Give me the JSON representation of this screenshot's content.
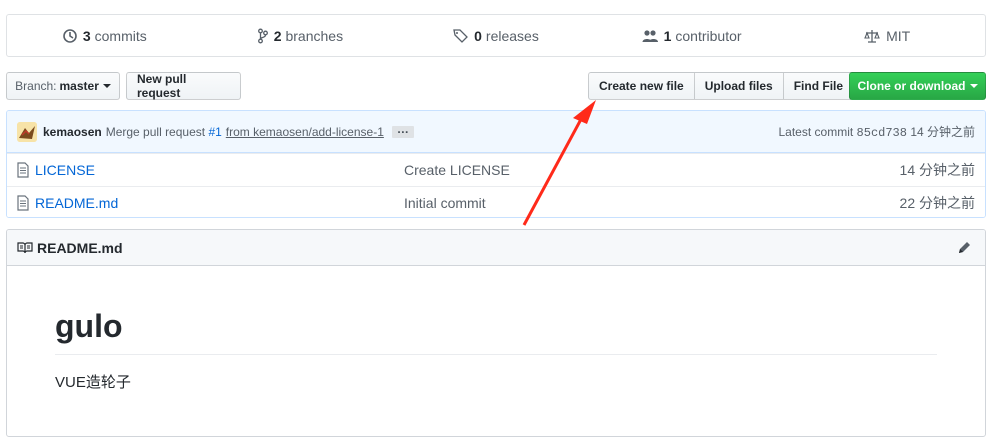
{
  "summary": {
    "commits": {
      "count": "3",
      "label": "commits"
    },
    "branches": {
      "count": "2",
      "label": "branches"
    },
    "releases": {
      "count": "0",
      "label": "releases"
    },
    "contributors": {
      "count": "1",
      "label": "contributor"
    },
    "license": "MIT"
  },
  "toolbar": {
    "branch_prefix": "Branch:",
    "branch_name": "master",
    "new_pull_request": "New pull request",
    "create_new_file": "Create new file",
    "upload_files": "Upload files",
    "find_file": "Find File",
    "clone_or_download": "Clone or download"
  },
  "latest_commit": {
    "author": "kemaosen",
    "message_prefix": "Merge pull request",
    "pr_number": "#1",
    "message_suffix": "from kemaosen/add-license-1",
    "ellipsis": "…",
    "latest_label": "Latest commit",
    "sha": "85cd738",
    "age": "14 分钟之前"
  },
  "files": [
    {
      "name": "LICENSE",
      "message": "Create LICENSE",
      "age": "14 分钟之前"
    },
    {
      "name": "README.md",
      "message": "Initial commit",
      "age": "22 分钟之前"
    }
  ],
  "readme": {
    "title": "README.md",
    "heading": "gulo",
    "paragraph": "VUE造轮子"
  },
  "colors": {
    "link": "#0366d6",
    "green": "#28a745",
    "annotation_arrow": "#ff2a1a"
  }
}
